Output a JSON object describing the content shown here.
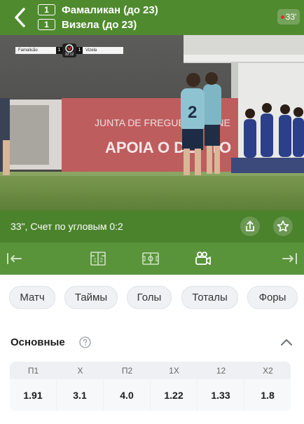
{
  "header": {
    "team1": {
      "score": "1",
      "name": "Фамаликан (до 23)"
    },
    "team2": {
      "score": "1",
      "name": "Визела (до 23)"
    },
    "live_minute": "33'",
    "colors": {
      "background": "#508a2f",
      "live_dot": "#e02b2b"
    }
  },
  "video": {
    "scorebug": {
      "home_team": "Famalicão",
      "home_score": "1",
      "clock": "32:12",
      "away_score": "1",
      "away_team": "Vizela"
    },
    "banner_text": "JUNTA DE FREGUE",
    "banner_text_2": "ANE",
    "banner_big": "APOIA O DE",
    "banner_big_2": "TO",
    "player_number": "2"
  },
  "info_bar": {
    "text": "33\", Счет по угловым 0:2",
    "share_icon": "share-icon",
    "favorite_icon": "star-icon"
  },
  "nav_bar": {
    "icons": [
      "prev-icon",
      "lineup-icon",
      "field-icon",
      "video-camera-icon",
      "next-icon"
    ],
    "active": "video-camera-icon"
  },
  "tabs": [
    {
      "label": "Матч"
    },
    {
      "label": "Таймы"
    },
    {
      "label": "Голы"
    },
    {
      "label": "Тоталы"
    },
    {
      "label": "Форы"
    }
  ],
  "section": {
    "title": "Основные",
    "help_icon": "help-icon",
    "collapse_icon": "chevron-up-icon"
  },
  "odds": {
    "headers": [
      "П1",
      "X",
      "П2",
      "1X",
      "12",
      "X2"
    ],
    "values": [
      "1.91",
      "3.1",
      "4.0",
      "1.22",
      "1.33",
      "1.8"
    ]
  }
}
